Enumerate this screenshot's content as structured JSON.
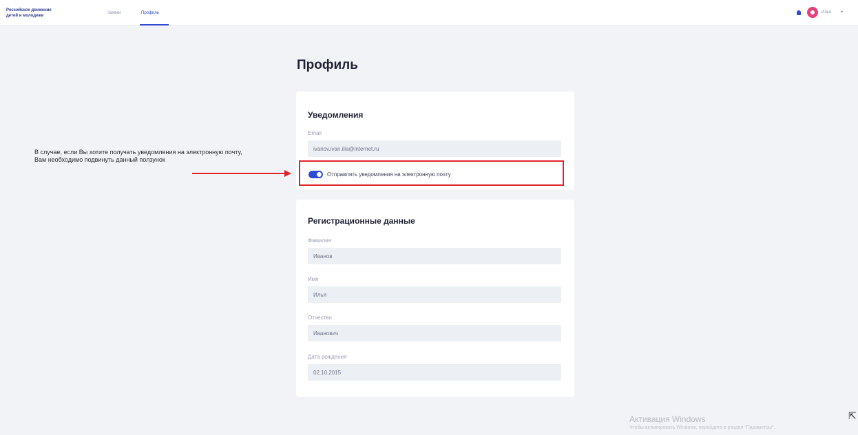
{
  "header": {
    "logo_line1": "Российское движение",
    "logo_line2": "детей и молодежи",
    "nav": [
      {
        "label": "Заявки",
        "active": false
      },
      {
        "label": "Профиль",
        "active": true
      }
    ],
    "user_name": "Илья",
    "accent_color": "#2f4bd6",
    "avatar_color": "#e4407a"
  },
  "page": {
    "title": "Профиль"
  },
  "notifications": {
    "title": "Уведомления",
    "email_label": "Email",
    "email_value": "ivanov.ivan.ilia@internet.ru",
    "toggle_label": "Отправлять уведомления на электронную почту",
    "toggle_on": true
  },
  "registration": {
    "title": "Регистрационные данные",
    "fields": [
      {
        "label": "Фамилия",
        "value": "Иванов"
      },
      {
        "label": "Имя",
        "value": "Илья"
      },
      {
        "label": "Отчество",
        "value": "Иванович"
      },
      {
        "label": "Дата рождения",
        "value": "02.10.2015"
      }
    ]
  },
  "annotation": {
    "line1": "В случае, если Вы хотите получать уведомления на электронную почту,",
    "line2": "Вам необходимо подвинуть данный ползунок",
    "color": "#e0232a"
  },
  "watermark": {
    "title": "Активация Windows",
    "text": "Чтобы активировать Windows, перейдите в раздел \"Параметры\"."
  }
}
